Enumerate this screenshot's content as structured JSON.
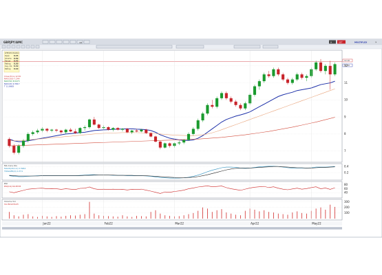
{
  "toolbar": {
    "symbol": "GBPJPY/AMC",
    "interval": "1D",
    "symbol_search_placeholder": "",
    "right_logo": "MULTIFLEX",
    "right_badge": "SET",
    "right_tab": "H"
  },
  "info_box": {
    "title": "LHP/Information",
    "rows": [
      {
        "label": "Open",
        "value": "8.45"
      },
      {
        "label": "Volume",
        "value": "8.50"
      },
      {
        "label": "Range",
        "value": "8.45"
      },
      {
        "label": "Rating",
        "value": "8.50"
      },
      {
        "label": "Avg. Cls",
        "value": "8.50"
      },
      {
        "label": "Rating",
        "value": "0.10"
      }
    ]
  },
  "main_legend": [
    {
      "label": "Close Price",
      "value": "12.50",
      "color": "#cc3333"
    },
    {
      "label": "MAV(200)",
      "value": "7.244",
      "color": "#cc3333"
    },
    {
      "label": "MAV(50)",
      "value": "8.5473",
      "color": "#1a8c3a"
    },
    {
      "label": "MAV(20)",
      "value": "9.7817",
      "color": "#1c2fa8"
    },
    {
      "label": "T",
      "value": "11.8683",
      "color": "#1c2fa8"
    }
  ],
  "price_tag": "12.10",
  "price_tag_2": "11.50",
  "macd_legend": {
    "title": "MA Conv Div",
    "line1": "MACD(26,12) 0.3962",
    "line2": "TRIGGER(9) 0.371"
  },
  "rsi_legend": {
    "title": "RSI",
    "line1": "RSI(14) 64.8745"
  },
  "volume_legend": {
    "title": "Volume Vol",
    "line1": "Vol 82123123"
  },
  "x_labels": [
    "Jan22",
    "Feb22",
    "Mar22",
    "Apr22",
    "May22"
  ],
  "colors": {
    "up": "#1a9a2e",
    "down": "#c8242b",
    "mav200": "#d24a3a",
    "mav50": "#e9a37a",
    "mav20": "#1c2fa8",
    "macd": "#2b8fbf",
    "signal": "#222222",
    "rsi": "#cc2222",
    "volume": "#d12c2c",
    "toolbar_bg": "#c7ccd6",
    "panel_border": "#7e8696"
  },
  "chart_data": [
    {
      "type": "candlestick",
      "title": "",
      "yticks": [
        7,
        8,
        9,
        10,
        11,
        12
      ],
      "ylim": [
        6.5,
        12.8
      ],
      "xlabels": [
        "Jan22",
        "Feb22",
        "Mar22",
        "Apr22",
        "May22"
      ],
      "ohlc": [
        [
          7.7,
          7.8,
          7.2,
          7.3
        ],
        [
          7.3,
          7.4,
          6.8,
          6.9
        ],
        [
          6.9,
          7.4,
          6.8,
          7.3
        ],
        [
          7.3,
          7.7,
          7.2,
          7.6
        ],
        [
          7.6,
          8.1,
          7.5,
          8.0
        ],
        [
          8.0,
          8.2,
          7.9,
          8.1
        ],
        [
          8.1,
          8.3,
          8.0,
          8.2
        ],
        [
          8.2,
          8.4,
          8.1,
          8.3
        ],
        [
          8.3,
          8.35,
          8.1,
          8.2
        ],
        [
          8.2,
          8.3,
          8.1,
          8.25
        ],
        [
          8.25,
          8.3,
          8.1,
          8.2
        ],
        [
          8.2,
          8.25,
          8.0,
          8.1
        ],
        [
          8.1,
          8.3,
          8.0,
          8.25
        ],
        [
          8.25,
          8.35,
          8.1,
          8.15
        ],
        [
          8.15,
          8.3,
          8.0,
          8.05
        ],
        [
          8.05,
          8.4,
          8.0,
          8.35
        ],
        [
          8.35,
          8.5,
          8.2,
          8.4
        ],
        [
          8.4,
          8.9,
          8.3,
          8.85
        ],
        [
          8.85,
          9.0,
          8.5,
          8.55
        ],
        [
          8.55,
          8.6,
          8.3,
          8.35
        ],
        [
          8.35,
          8.5,
          8.25,
          8.4
        ],
        [
          8.4,
          8.45,
          8.2,
          8.25
        ],
        [
          8.25,
          8.4,
          8.15,
          8.35
        ],
        [
          8.35,
          8.4,
          8.2,
          8.25
        ],
        [
          8.25,
          8.35,
          8.15,
          8.3
        ],
        [
          8.3,
          8.35,
          8.05,
          8.1
        ],
        [
          8.1,
          8.25,
          8.0,
          8.2
        ],
        [
          8.2,
          8.3,
          8.1,
          8.15
        ],
        [
          8.15,
          8.3,
          8.1,
          8.25
        ],
        [
          8.25,
          8.3,
          8.0,
          8.05
        ],
        [
          8.05,
          8.1,
          7.8,
          7.85
        ],
        [
          7.85,
          7.9,
          7.5,
          7.55
        ],
        [
          7.55,
          7.6,
          7.1,
          7.2
        ],
        [
          7.2,
          7.5,
          7.15,
          7.45
        ],
        [
          7.45,
          7.5,
          7.2,
          7.3
        ],
        [
          7.3,
          7.5,
          7.2,
          7.45
        ],
        [
          7.45,
          7.6,
          7.35,
          7.5
        ],
        [
          7.5,
          7.7,
          7.4,
          7.65
        ],
        [
          7.65,
          8.1,
          7.6,
          8.0
        ],
        [
          8.0,
          8.4,
          7.9,
          8.3
        ],
        [
          8.3,
          8.9,
          8.2,
          8.8
        ],
        [
          8.8,
          9.3,
          8.7,
          9.2
        ],
        [
          9.2,
          9.8,
          9.1,
          9.7
        ],
        [
          9.7,
          10.0,
          9.5,
          9.6
        ],
        [
          9.6,
          10.2,
          9.5,
          10.1
        ],
        [
          10.1,
          10.5,
          10.0,
          10.4
        ],
        [
          10.4,
          10.5,
          10.0,
          10.1
        ],
        [
          10.1,
          10.2,
          9.8,
          9.9
        ],
        [
          9.9,
          10.0,
          9.6,
          9.7
        ],
        [
          9.7,
          9.8,
          9.4,
          9.5
        ],
        [
          9.5,
          9.9,
          9.4,
          9.8
        ],
        [
          9.8,
          10.4,
          9.7,
          10.3
        ],
        [
          10.3,
          10.9,
          10.2,
          10.8
        ],
        [
          10.8,
          11.2,
          10.6,
          11.1
        ],
        [
          11.1,
          11.6,
          11.0,
          11.5
        ],
        [
          11.5,
          11.7,
          11.3,
          11.4
        ],
        [
          11.4,
          11.9,
          11.3,
          11.8
        ],
        [
          11.8,
          11.9,
          11.4,
          11.5
        ],
        [
          11.5,
          11.6,
          11.1,
          11.2
        ],
        [
          11.2,
          11.3,
          10.9,
          11.0
        ],
        [
          11.0,
          11.3,
          10.9,
          11.2
        ],
        [
          11.2,
          11.6,
          11.1,
          11.5
        ],
        [
          11.5,
          11.6,
          11.2,
          11.3
        ],
        [
          11.3,
          11.5,
          11.1,
          11.4
        ],
        [
          11.4,
          11.9,
          11.3,
          11.8
        ],
        [
          11.8,
          12.3,
          11.7,
          12.2
        ],
        [
          12.2,
          12.4,
          11.6,
          11.7
        ],
        [
          11.7,
          12.1,
          11.5,
          12.0
        ],
        [
          12.0,
          12.3,
          10.6,
          11.5
        ],
        [
          11.5,
          12.2,
          11.4,
          12.1
        ]
      ],
      "series": [
        {
          "name": "MAV(20)",
          "color": "#1c2fa8",
          "values": [
            7.7,
            7.6,
            7.55,
            7.55,
            7.6,
            7.65,
            7.7,
            7.75,
            7.8,
            7.85,
            7.9,
            7.95,
            8.0,
            8.02,
            8.05,
            8.08,
            8.1,
            8.15,
            8.2,
            8.22,
            8.24,
            8.25,
            8.27,
            8.28,
            8.29,
            8.3,
            8.3,
            8.28,
            8.27,
            8.25,
            8.2,
            8.1,
            7.95,
            7.85,
            7.75,
            7.7,
            7.65,
            7.62,
            7.62,
            7.65,
            7.75,
            7.9,
            8.1,
            8.3,
            8.5,
            8.7,
            8.85,
            8.95,
            9.05,
            9.12,
            9.2,
            9.3,
            9.45,
            9.6,
            9.75,
            9.9,
            10.05,
            10.2,
            10.3,
            10.38,
            10.45,
            10.55,
            10.6,
            10.65,
            10.7,
            10.8,
            10.9,
            10.95,
            11.0,
            11.1
          ]
        },
        {
          "name": "MAV(50)",
          "color": "#e9a37a",
          "values": [
            7.6,
            7.6,
            7.6,
            7.62,
            7.65,
            7.68,
            7.7,
            7.72,
            7.75,
            7.78,
            7.8,
            7.82,
            7.85,
            7.87,
            7.9,
            7.92,
            7.95,
            7.97,
            8.0,
            8.02,
            8.04,
            8.05,
            8.06,
            8.07,
            8.08,
            8.08,
            8.08,
            8.08,
            8.07,
            8.06,
            8.05,
            8.03,
            8.0,
            7.97,
            7.95,
            7.93,
            7.92,
            7.91,
            7.9,
            7.9,
            7.92,
            7.95,
            8.0,
            8.07,
            8.15,
            8.25,
            8.35,
            8.45,
            8.55,
            8.65,
            8.75,
            8.85,
            8.95,
            9.05,
            9.15,
            9.25,
            9.35,
            9.45,
            9.55,
            9.65,
            9.75,
            9.85,
            9.95,
            10.05,
            10.15,
            10.25,
            10.35,
            10.45,
            10.55,
            10.65
          ]
        },
        {
          "name": "MAV(200)",
          "color": "#d24a3a",
          "values": [
            7.3,
            7.31,
            7.32,
            7.33,
            7.34,
            7.35,
            7.36,
            7.37,
            7.38,
            7.39,
            7.4,
            7.41,
            7.42,
            7.43,
            7.44,
            7.45,
            7.46,
            7.47,
            7.48,
            7.49,
            7.5,
            7.51,
            7.52,
            7.53,
            7.54,
            7.55,
            7.56,
            7.57,
            7.58,
            7.59,
            7.6,
            7.61,
            7.62,
            7.63,
            7.64,
            7.65,
            7.66,
            7.67,
            7.68,
            7.69,
            7.7,
            7.72,
            7.74,
            7.76,
            7.78,
            7.8,
            7.83,
            7.86,
            7.89,
            7.92,
            7.95,
            7.99,
            8.03,
            8.07,
            8.11,
            8.15,
            8.2,
            8.25,
            8.3,
            8.35,
            8.4,
            8.46,
            8.52,
            8.58,
            8.64,
            8.7,
            8.77,
            8.84,
            8.91,
            8.98
          ]
        }
      ]
    },
    {
      "type": "line",
      "title": "MA Conv Div",
      "yticks": [
        0.4,
        0.2
      ],
      "series": [
        {
          "name": "MACD(26,12)",
          "color": "#2b8fbf",
          "values": [
            0.1,
            0.08,
            0.07,
            0.07,
            0.08,
            0.09,
            0.1,
            0.1,
            0.1,
            0.1,
            0.1,
            0.1,
            0.1,
            0.1,
            0.1,
            0.11,
            0.12,
            0.13,
            0.13,
            0.12,
            0.12,
            0.12,
            0.11,
            0.11,
            0.11,
            0.1,
            0.1,
            0.1,
            0.1,
            0.09,
            0.08,
            0.06,
            0.04,
            0.03,
            0.02,
            0.02,
            0.02,
            0.03,
            0.05,
            0.08,
            0.12,
            0.17,
            0.23,
            0.28,
            0.32,
            0.36,
            0.38,
            0.38,
            0.37,
            0.35,
            0.34,
            0.35,
            0.37,
            0.39,
            0.4,
            0.41,
            0.41,
            0.4,
            0.38,
            0.36,
            0.35,
            0.35,
            0.35,
            0.35,
            0.36,
            0.38,
            0.38,
            0.38,
            0.39,
            0.4
          ]
        },
        {
          "name": "TRIGGER(9)",
          "color": "#222222",
          "values": [
            0.11,
            0.1,
            0.09,
            0.09,
            0.09,
            0.09,
            0.09,
            0.1,
            0.1,
            0.1,
            0.1,
            0.1,
            0.1,
            0.1,
            0.1,
            0.1,
            0.11,
            0.11,
            0.12,
            0.12,
            0.12,
            0.12,
            0.12,
            0.11,
            0.11,
            0.11,
            0.11,
            0.1,
            0.1,
            0.1,
            0.09,
            0.08,
            0.07,
            0.06,
            0.05,
            0.04,
            0.03,
            0.03,
            0.04,
            0.05,
            0.07,
            0.1,
            0.13,
            0.17,
            0.21,
            0.25,
            0.29,
            0.32,
            0.34,
            0.35,
            0.35,
            0.35,
            0.36,
            0.37,
            0.38,
            0.39,
            0.4,
            0.4,
            0.39,
            0.38,
            0.37,
            0.36,
            0.36,
            0.35,
            0.35,
            0.36,
            0.37,
            0.37,
            0.38,
            0.39
          ]
        }
      ]
    },
    {
      "type": "line",
      "title": "RSI",
      "yticks": [
        80,
        60,
        40
      ],
      "ylim": [
        20,
        90
      ],
      "series": [
        {
          "name": "RSI(14)",
          "color": "#cc2222",
          "values": [
            45,
            40,
            46,
            52,
            58,
            60,
            62,
            63,
            60,
            61,
            60,
            57,
            60,
            58,
            56,
            62,
            63,
            69,
            60,
            56,
            58,
            56,
            58,
            56,
            57,
            54,
            57,
            56,
            58,
            53,
            48,
            42,
            36,
            44,
            42,
            46,
            49,
            53,
            60,
            64,
            69,
            72,
            75,
            70,
            72,
            74,
            66,
            60,
            56,
            52,
            58,
            64,
            68,
            70,
            72,
            66,
            70,
            63,
            58,
            55,
            59,
            63,
            58,
            61,
            66,
            70,
            60,
            64,
            57,
            65
          ]
        }
      ]
    },
    {
      "type": "bar",
      "title": "Volume Vol",
      "yticks": [
        300,
        200,
        100
      ],
      "values": [
        120,
        60,
        40,
        70,
        80,
        40,
        30,
        50,
        40,
        30,
        45,
        35,
        50,
        60,
        55,
        70,
        80,
        300,
        90,
        60,
        50,
        45,
        40,
        35,
        60,
        40,
        30,
        50,
        45,
        40,
        120,
        150,
        90,
        60,
        50,
        40,
        45,
        60,
        80,
        100,
        140,
        200,
        180,
        120,
        150,
        170,
        110,
        90,
        70,
        60,
        140,
        180,
        160,
        130,
        150,
        120,
        110,
        90,
        80,
        70,
        110,
        130,
        100,
        90,
        140,
        180,
        200,
        160,
        250,
        210
      ]
    }
  ]
}
